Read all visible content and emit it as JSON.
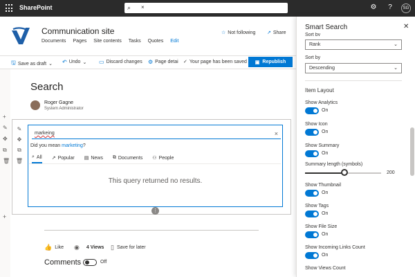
{
  "suitebar": {
    "brand": "SharePoint",
    "search_value": "×",
    "avatar_initials": "SG"
  },
  "site": {
    "title": "Communication site",
    "nav": [
      "Documents",
      "Pages",
      "Site contents",
      "Tasks",
      "Quotes"
    ],
    "edit_label": "Edit",
    "following_label": "Not following",
    "share_label": "Share"
  },
  "commandbar": {
    "save_draft": "Save as draft",
    "undo": "Undo",
    "discard": "Discard changes",
    "page_details": "Page detai",
    "status": "Your page has been saved",
    "republish": "Republish"
  },
  "page": {
    "title": "Search",
    "author_name": "Roger Gagne",
    "author_role": "System Administrator"
  },
  "webpart": {
    "query": "markeing",
    "did_you_mean_prefix": "Did you mean ",
    "did_you_mean_link": "marketing",
    "did_you_mean_suffix": "?",
    "tabs": [
      {
        "label": "All",
        "icon": "search-icon"
      },
      {
        "label": "Popular",
        "icon": "trending-icon"
      },
      {
        "label": "News",
        "icon": "news-icon"
      },
      {
        "label": "Documents",
        "icon": "documents-icon"
      },
      {
        "label": "People",
        "icon": "people-icon"
      }
    ],
    "no_results": "This query returned no results."
  },
  "social": {
    "like": "Like",
    "views": "4 Views",
    "save_later": "Save for later",
    "comments_label": "Comments",
    "comments_toggle": "Off"
  },
  "panel": {
    "title": "Smart Search",
    "cut_label": "Sort by",
    "rank_value": "Rank",
    "sort_by_label": "Sort by",
    "sort_by_value": "Descending",
    "item_layout": "Item Layout",
    "toggles": [
      {
        "label": "Show Analytics",
        "state": "On"
      },
      {
        "label": "Show Icon",
        "state": "On"
      },
      {
        "label": "Show Summary",
        "state": "On"
      }
    ],
    "summary_length_label": "Summary length (symbols)",
    "summary_length_value": "200",
    "summary_length_fraction": 0.52,
    "toggles2": [
      {
        "label": "Show Thumbnail",
        "state": "On"
      },
      {
        "label": "Show Tags",
        "state": "On"
      },
      {
        "label": "Show File Size",
        "state": "On"
      },
      {
        "label": "Show Incoming Links Count",
        "state": "On"
      }
    ],
    "last_label": "Show Views Count"
  },
  "colors": {
    "accent": "#0078d4",
    "suitebar": "#2b2b2b"
  }
}
